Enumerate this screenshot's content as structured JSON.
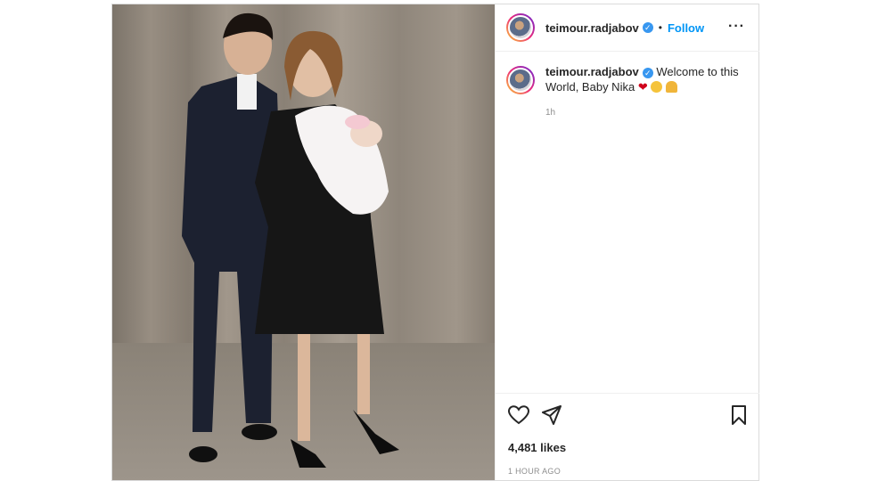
{
  "post": {
    "author": "teimour.radjabov",
    "follow_label": "Follow",
    "dot": "•",
    "caption": "Welcome to this World, Baby Nika",
    "caption_emojis": [
      "red-heart",
      "smiling-face-with-hearts",
      "folded-hands"
    ],
    "comment_time": "1h",
    "likes": "4,481 likes",
    "posted_ago": "1 HOUR AGO"
  },
  "icons": {
    "more": "more-options-icon",
    "verified": "verified-badge-icon",
    "like": "heart-icon",
    "share": "share-icon",
    "save": "bookmark-icon"
  },
  "colors": {
    "follow": "#0095f6",
    "verified": "#3897f0",
    "muted": "#8e8e8e"
  }
}
